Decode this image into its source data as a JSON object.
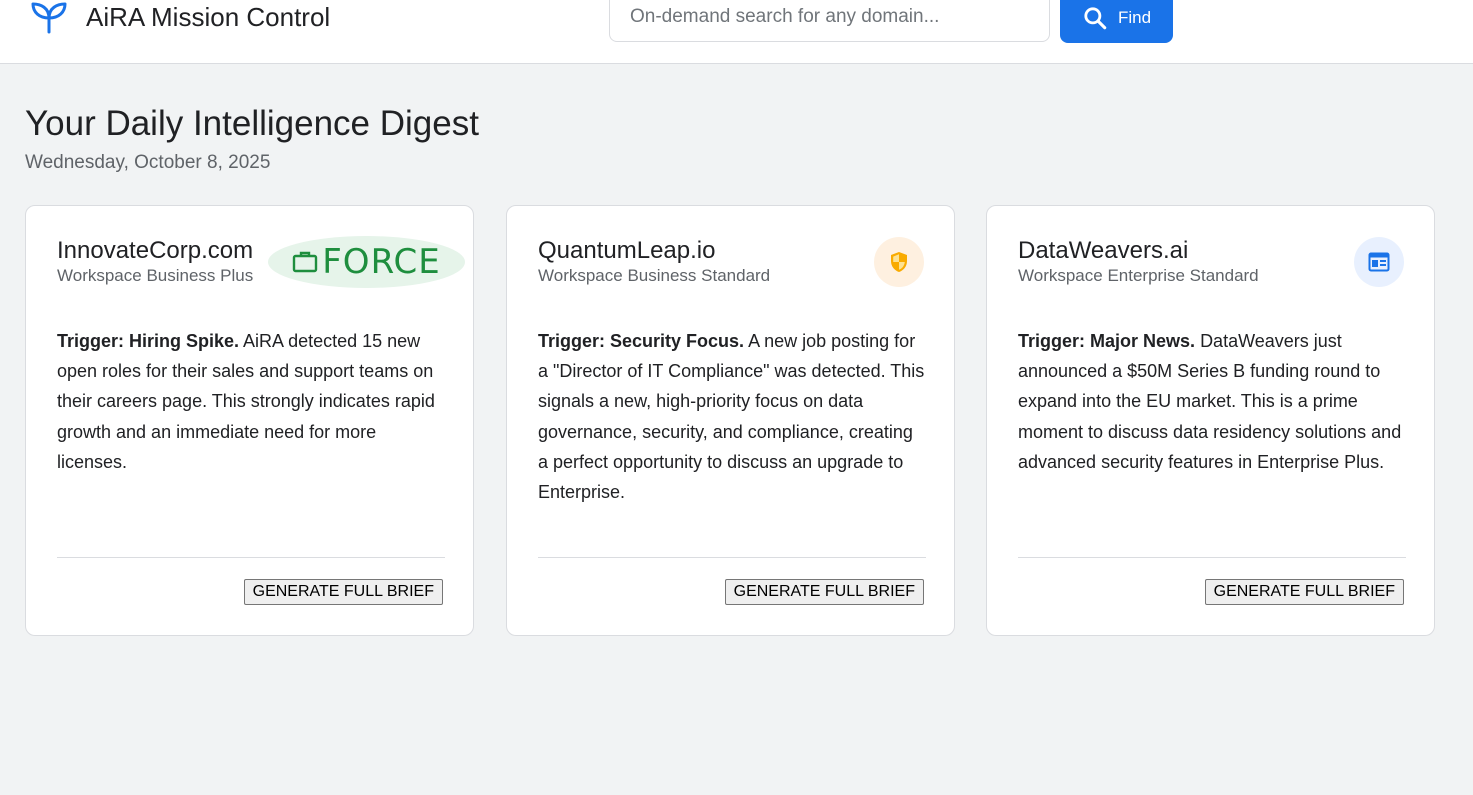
{
  "app": {
    "title": "AiRA Mission Control",
    "logo_icon": "sprout-icon",
    "accent_color": "#1a73e8"
  },
  "search": {
    "placeholder": "On-demand search for any domain...",
    "value": "",
    "button_label": "Find",
    "button_icon": "search-icon"
  },
  "digest": {
    "title": "Your Daily Intelligence Digest",
    "date": "Wednesday, October 8, 2025"
  },
  "cards": [
    {
      "domain": "InnovateCorp.com",
      "plan": "Workspace Business Plus",
      "badge_text": "FORCE",
      "badge_icon": "briefcase-icon",
      "badge_color": "#1e8e3e",
      "trigger_label": "Trigger: Hiring Spike.",
      "description": "AiRA detected 15 new open roles for their sales and support teams on their careers page. This strongly indicates rapid growth and an immediate need for more licenses.",
      "button_label": "GENERATE FULL BRIEF"
    },
    {
      "domain": "QuantumLeap.io",
      "plan": "Workspace Business Standard",
      "badge_icon": "shield-icon",
      "badge_color": "#f9ab00",
      "trigger_label": "Trigger: Security Focus.",
      "description": "A new job posting for a \"Director of IT Compliance\" was detected. This signals a new, high-priority focus on data governance, security, and compliance, creating a perfect opportunity to discuss an upgrade to Enterprise.",
      "button_label": "GENERATE FULL BRIEF"
    },
    {
      "domain": "DataWeavers.ai",
      "plan": "Workspace Enterprise Standard",
      "badge_icon": "newspaper-icon",
      "badge_color": "#1a73e8",
      "trigger_label": "Trigger: Major News.",
      "description": "DataWeavers just announced a $50M Series B funding round to expand into the EU market. This is a prime moment to discuss data residency solutions and advanced security features in Enterprise Plus.",
      "button_label": "GENERATE FULL BRIEF"
    }
  ]
}
